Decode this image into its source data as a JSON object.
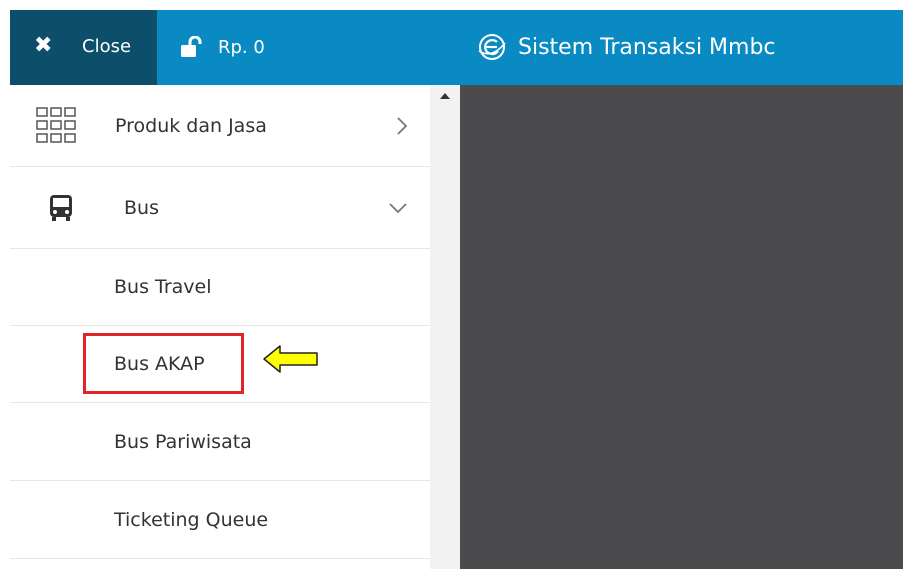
{
  "topbar": {
    "close_label": "Close",
    "balance_label": "Rp. 0",
    "app_title": "Sistem Transaksi Mmbc",
    "colors": {
      "bar": "#0a8ac2",
      "close_bg": "#0d4f6b"
    }
  },
  "sidebar": {
    "items": [
      {
        "label": "Produk dan Jasa",
        "icon": "grid-icon",
        "chevron": "chevron-right-icon"
      },
      {
        "label": "Bus",
        "icon": "bus-icon",
        "chevron": "chevron-down-icon"
      },
      {
        "label": "Bus Travel"
      },
      {
        "label": "Bus AKAP"
      },
      {
        "label": "Bus Pariwisata"
      },
      {
        "label": "Ticketing Queue"
      }
    ]
  },
  "annotation": {
    "highlight_color": "#e0252a",
    "arrow_color": "#ffff00"
  }
}
